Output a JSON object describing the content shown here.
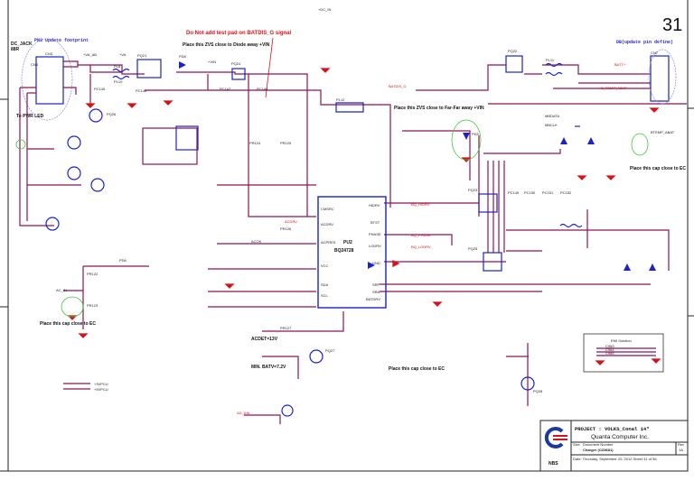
{
  "sheet": {
    "page_number": "31"
  },
  "notes": {
    "batdis_warning": "Do Not add test pad on BATDIS_G signal",
    "zvs_diode": "Place this ZVS close to Diode away +VIN",
    "zvs_far": "Place this ZVS close to Far-Far away +VIN",
    "pwr_led": "To PWR LED",
    "cap_close_ec_1": "Place this cap close to EC",
    "cap_close_ec_2": "Place this cap close to EC",
    "cap_close_ec_3": "Place this cap close to EC",
    "acdet": "ACDET=13V",
    "min_batv": "MIN. BATV=7.2V",
    "dc_jack": "DC_JACK",
    "dc_jack_sub": "88R",
    "pn3_footprint": "PN3 Update footprint",
    "db_update": "DB(update pin define)",
    "emi_solution": "EMI Solution"
  },
  "chip": {
    "ref": "PU2",
    "part": "BQ24728",
    "left_pins": [
      "CMSRC",
      "ACDRV",
      "ACPRES",
      "VCC",
      "SDA",
      "SCL"
    ],
    "right_pins": [
      "HIDRV",
      "BTST",
      "PHASE",
      "LODRV",
      "GND",
      "SRP",
      "SRN",
      "BATDRV"
    ]
  },
  "nets": {
    "dc_in": "+DC_IN",
    "vin": "+VIN",
    "va": "+VA",
    "vaa": "+VA_AB",
    "ac_in": "AC_IN",
    "batt_plus": "BATT+",
    "batt_temp": "B_TEMP_ABAT",
    "mbdata": "MBDATA",
    "mbclk": "MBCLK",
    "pu3vpcu": "+3VPCU",
    "pu5vpcu": "+5VPCU",
    "bat_temp_ec": "BTEMP_ABAT",
    "ad_ain": "AD_AIN",
    "acok": "ACOK",
    "batdis": "BATDIS_G",
    "net_acdrv": "ACDRV",
    "net_hidrv": "BQ_HIDRV",
    "net_lodrv": "BQ_LODRV",
    "net_phase": "BQ_PHASE"
  },
  "components": {
    "pq": [
      "PQ21",
      "PQ24",
      "PQ22",
      "PQ23",
      "PQ25",
      "PQ26",
      "PQ27",
      "PQ28"
    ],
    "pl": [
      "PL8",
      "PL10",
      "PL11",
      "PL12"
    ],
    "pd": [
      "PD6",
      "PD8",
      "PD9"
    ],
    "pc": [
      "PC145",
      "PC146",
      "PC147",
      "PC148",
      "PC149",
      "PC150",
      "PC151",
      "PC152"
    ],
    "pr": [
      "PR122",
      "PR123",
      "PR124",
      "PR125",
      "PR126",
      "PR127"
    ],
    "cn": [
      "CN3",
      "CN7"
    ],
    "emi_caps": [
      "C983",
      "C984",
      "C985"
    ]
  },
  "title_block": {
    "project": "PROJECT : VOLKS_Conal 14\"",
    "company": "Quanta Computer Inc.",
    "logo_text": "NBS",
    "size_label": "Size",
    "doc_label": "Document Number",
    "doc_title": "Charger (OZ8681)",
    "rev_label": "Rev",
    "rev": "1A",
    "date_row": "Date: Thursday, September 20, 2012   Sheet 31 of 56"
  },
  "colors": {
    "wire": "#8a1553",
    "component": "#1a22c8",
    "ground": "#d0141a",
    "note_red": "#e0101a",
    "zone": "#3ec93e"
  }
}
